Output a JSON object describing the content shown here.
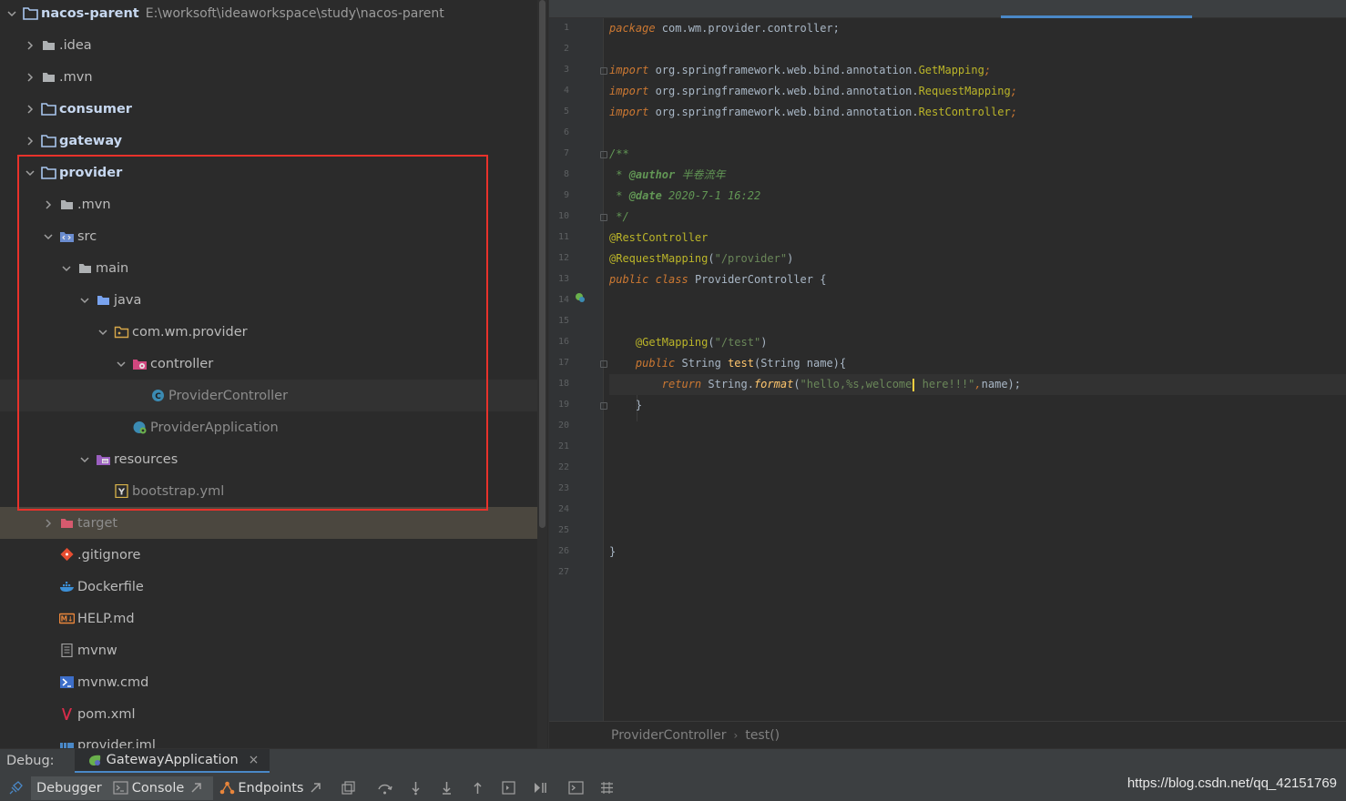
{
  "colors": {
    "background": "#2b2b2b",
    "highlight_box": "#e8322b",
    "keyword": "#cc7832",
    "annotation": "#bbb529",
    "string": "#6a8759",
    "comment": "#629755",
    "accent_blue": "#4a88c7"
  },
  "project_tree": {
    "root": {
      "name": "nacos-parent",
      "path": "E:\\worksoft\\ideaworkspace\\study\\nacos-parent",
      "icon": "folder-icon"
    },
    "items": [
      {
        "label": ".idea",
        "icon": "folder-icon"
      },
      {
        "label": ".mvn",
        "icon": "folder-icon"
      },
      {
        "label": "consumer",
        "icon": "module-folder-icon"
      },
      {
        "label": "gateway",
        "icon": "module-folder-icon"
      },
      {
        "label": "provider",
        "icon": "module-folder-icon"
      },
      {
        "label": ".mvn",
        "icon": "folder-icon"
      },
      {
        "label": "src",
        "icon": "source-folder-icon"
      },
      {
        "label": "main",
        "icon": "folder-icon"
      },
      {
        "label": "java",
        "icon": "source-root-icon"
      },
      {
        "label": "com.wm.provider",
        "icon": "package-icon"
      },
      {
        "label": "controller",
        "icon": "spring-package-icon"
      },
      {
        "label": "ProviderController",
        "icon": "class-icon"
      },
      {
        "label": "ProviderApplication",
        "icon": "spring-boot-class-icon"
      },
      {
        "label": "resources",
        "icon": "resources-folder-icon"
      },
      {
        "label": "bootstrap.yml",
        "icon": "yaml-file-icon"
      },
      {
        "label": "target",
        "icon": "excluded-folder-icon"
      },
      {
        "label": ".gitignore",
        "icon": "git-icon"
      },
      {
        "label": "Dockerfile",
        "icon": "docker-icon"
      },
      {
        "label": "HELP.md",
        "icon": "markdown-icon"
      },
      {
        "label": "mvnw",
        "icon": "script-file-icon"
      },
      {
        "label": "mvnw.cmd",
        "icon": "cmd-file-icon"
      },
      {
        "label": "pom.xml",
        "icon": "maven-icon"
      },
      {
        "label": "provider.iml",
        "icon": "iml-file-icon"
      }
    ]
  },
  "editor": {
    "line_numbers": [
      "1",
      "2",
      "3",
      "4",
      "5",
      "6",
      "7",
      "8",
      "9",
      "10",
      "11",
      "12",
      "13",
      "14",
      "15",
      "16",
      "17",
      "18",
      "19",
      "20",
      "21",
      "22",
      "23",
      "24",
      "25",
      "26",
      "27"
    ],
    "code": {
      "l1_kw": "package",
      "l1_rest": " com.wm.provider.controller;",
      "import_kw": "import",
      "l3_rest": " org.springframework.web.bind.annotation.",
      "l3_cls": "GetMapping",
      "l4_cls": "RequestMapping",
      "l5_cls": "RestController",
      "semicolon": ";",
      "l7": "/**",
      "l8_star": " * ",
      "l8_tag": "@author",
      "l8_val": " 半卷流年",
      "l9_tag": "@date",
      "l9_val": " 2020-7-1 16:22",
      "l10": " */",
      "l11": "@RestController",
      "l12_anno": "@RequestMapping",
      "l12_open": "(",
      "l12_str": "\"/provider\"",
      "l12_close": ")",
      "l13_kw1": "public",
      "l13_kw2": "class",
      "l13_name": " ProviderController {",
      "l16_anno": "@GetMapping",
      "l16_open": "(",
      "l16_str": "\"/test\"",
      "l16_close": ")",
      "l17_kw": "public",
      "l17_type": " String ",
      "l17_method": "test",
      "l17_params": "(String ",
      "l17_pname": "name",
      "l17_end": "){",
      "l18_kw": "return",
      "l18_cls": " String.",
      "l18_method": "format",
      "l18_open": "(",
      "l18_str1": "\"hello,%s,welcome",
      "l18_str2": " here!!!\"",
      "l18_comma": ",",
      "l18_pname": "name",
      "l18_end": ");",
      "l19": "}",
      "l26": "}"
    },
    "breadcrumbs": [
      "ProviderController",
      "test()"
    ]
  },
  "debug": {
    "label": "Debug:",
    "session_tab": "GatewayApplication",
    "close_glyph": "×",
    "tabs": [
      {
        "label": "Debugger"
      },
      {
        "label": "Console",
        "icon": "console-icon"
      },
      {
        "label": "Endpoints",
        "icon": "endpoints-icon"
      }
    ],
    "toolbar_icons": [
      "restore-layout-icon",
      "step-over-icon",
      "step-into-icon",
      "force-step-into-icon",
      "step-out-icon",
      "run-to-cursor-icon",
      "evaluate-icon",
      "console-toggle-icon",
      "threads-icon"
    ]
  },
  "watermark": "https://blog.csdn.net/qq_42151769"
}
